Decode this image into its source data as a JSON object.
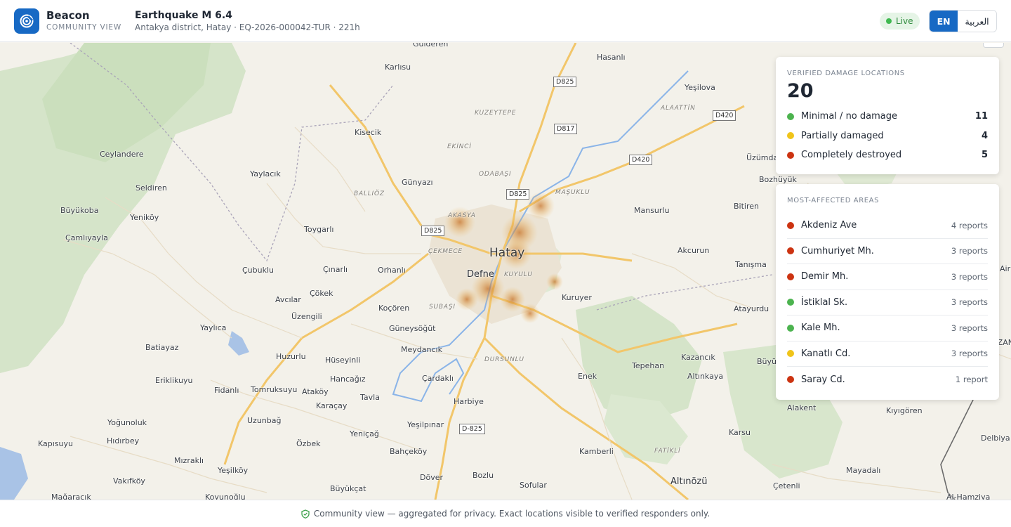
{
  "app": {
    "name": "Beacon",
    "subtitle": "COMMUNITY VIEW"
  },
  "event": {
    "title": "Earthquake M 6.4",
    "details": "Antakya district, Hatay · EQ-2026-000042-TUR · 221h"
  },
  "status": {
    "live_label": "Live",
    "live_color": "#3fb950"
  },
  "language": {
    "options": [
      "EN",
      "العربية"
    ],
    "selected": "EN"
  },
  "verified": {
    "heading": "VERIFIED DAMAGE LOCATIONS",
    "total": "20",
    "rows": [
      {
        "label": "Minimal / no damage",
        "count": "11",
        "color": "#4cb34f"
      },
      {
        "label": "Partially damaged",
        "count": "4",
        "color": "#f0c419"
      },
      {
        "label": "Completely destroyed",
        "count": "5",
        "color": "#cc3311"
      }
    ]
  },
  "areas": {
    "heading": "MOST-AFFECTED AREAS",
    "rows": [
      {
        "label": "Akdeniz Ave",
        "count": "4 reports",
        "color": "#cc3311"
      },
      {
        "label": "Cumhuriyet Mh.",
        "count": "3 reports",
        "color": "#cc3311"
      },
      {
        "label": "Demir Mh.",
        "count": "3 reports",
        "color": "#cc3311"
      },
      {
        "label": "İstiklal Sk.",
        "count": "3 reports",
        "color": "#4cb34f"
      },
      {
        "label": "Kale Mh.",
        "count": "3 reports",
        "color": "#4cb34f"
      },
      {
        "label": "Kanatlı Cd.",
        "count": "3 reports",
        "color": "#f0c419"
      },
      {
        "label": "Saray Cd.",
        "count": "1 report",
        "color": "#cc3311"
      }
    ]
  },
  "map": {
    "places": [
      "Gulderen",
      "Karlısu",
      "Hasanlı",
      "Yeşilova",
      "Kisecik",
      "Ceylandere",
      "Yaylacık",
      "Seldiren",
      "Günyazı",
      "Büyükoba",
      "Yeniköy",
      "Çamlıyayla",
      "Toygarlı",
      "Mansurlu",
      "Bitiren",
      "Üzümdalı",
      "Bozhüyük",
      "Çubuklu",
      "Çınarlı",
      "Orhanlı",
      "Akcurun",
      "Tanışma",
      "Çökek",
      "Avcılar",
      "Kuruyer",
      "Koçören",
      "Üzengili",
      "Atayurdu",
      "Yaylıca",
      "Güneysöğüt",
      "Batiayaz",
      "Meydancık",
      "Huzurlu",
      "Hüseyinli",
      "Kazancık",
      "Büyükbur",
      "Tepehan",
      "Eriklikuyu",
      "Hancağız",
      "Çardaklı",
      "Enek",
      "Altınkaya",
      "Fidanlı",
      "Tomruksuyu",
      "Ataköy",
      "Karaçay",
      "Tavla",
      "Harbiye",
      "Alakent",
      "Kıyıgören",
      "Yoğunoluk",
      "Uzunbağ",
      "Yeşilpınar",
      "Hıdırbey",
      "Kapısuyu",
      "Yeniçağ",
      "Özbek",
      "Karsu",
      "Kamberli",
      "Bahçeköy",
      "Delbiya",
      "Mızraklı",
      "Yeşilköy",
      "Mayadalı",
      "Vakıfköy",
      "Döver",
      "Bozlu",
      "Sofular",
      "Altınözü",
      "Çetenli",
      "Büyükçat",
      "Mağaracık",
      "Koyunoğlu",
      "Al-Hamziya",
      "Defne"
    ],
    "city": "Hatay",
    "districts": [
      "KUZEYTEPE",
      "EKİNCİ",
      "ODABAŞI",
      "ALAATTİN",
      "MAŞUKLU",
      "BALLIÖZ",
      "AKASYA",
      "ÇEKMECE",
      "KUYULU",
      "SUBAŞI",
      "DURSUNLU",
      "FATİKLİ"
    ],
    "roads": [
      "D825",
      "D817",
      "D420",
      "D420",
      "D825",
      "D825",
      "D-825"
    ],
    "edge_labels": [
      "OZAN",
      "Air"
    ]
  },
  "footer": {
    "note": "Community view — aggregated for privacy. Exact locations visible to verified responders only."
  }
}
